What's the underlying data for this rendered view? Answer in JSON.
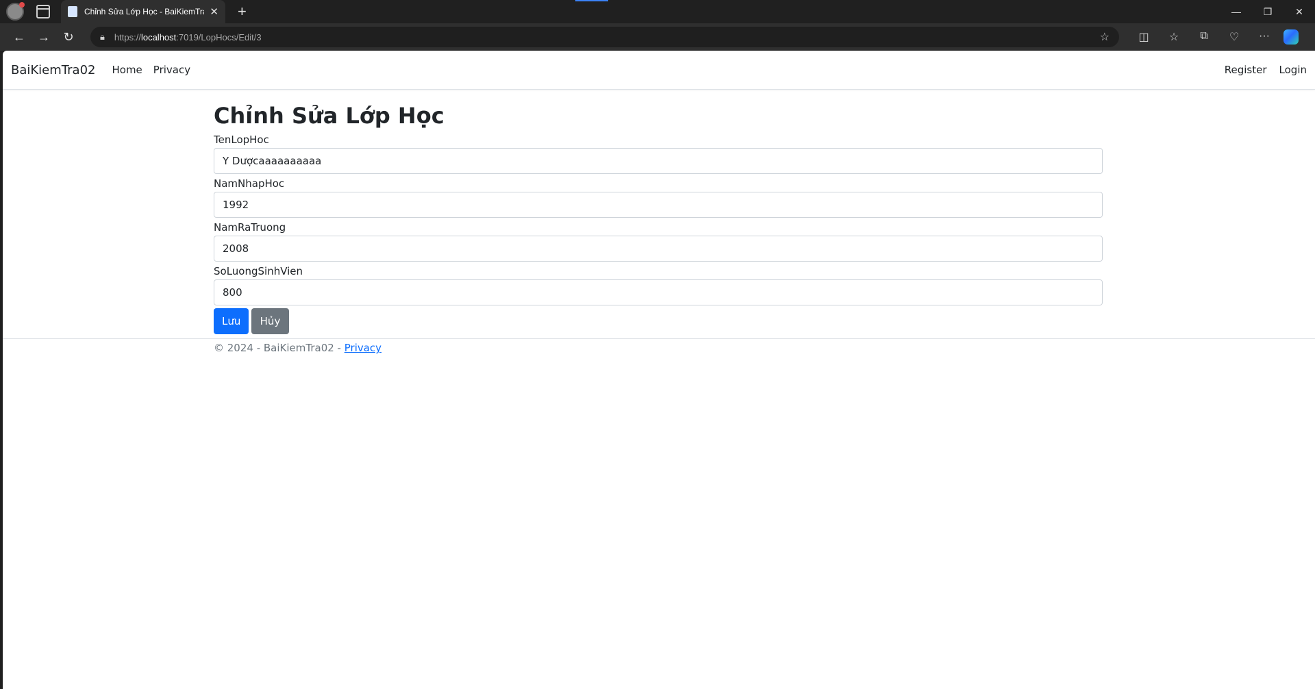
{
  "browser": {
    "tab_title": "Chỉnh Sửa Lớp Học - BaiKiemTra02",
    "url_scheme": "https://",
    "url_host": "localhost",
    "url_path": ":7019/LopHocs/Edit/3",
    "icons": [
      "profile-icon",
      "tab-actions-icon",
      "close-icon",
      "new-tab-icon",
      "back-icon",
      "forward-icon",
      "refresh-icon",
      "lock-icon",
      "star-icon",
      "split-screen-icon",
      "favorites-icon",
      "collections-icon",
      "browser-essentials-icon",
      "more-icon",
      "copilot-icon",
      "minimize-icon",
      "restore-icon",
      "window-close-icon"
    ]
  },
  "navbar": {
    "brand": "BaiKiemTra02",
    "links": [
      "Home",
      "Privacy"
    ],
    "right_links": [
      "Register",
      "Login"
    ]
  },
  "page": {
    "title": "Chỉnh Sửa Lớp Học",
    "fields": [
      {
        "label": "TenLopHoc",
        "value": "Y Dượcaaaaaaaaaa"
      },
      {
        "label": "NamNhapHoc",
        "value": "1992"
      },
      {
        "label": "NamRaTruong",
        "value": "2008"
      },
      {
        "label": "SoLuongSinhVien",
        "value": "800"
      }
    ],
    "save_label": "Lưu",
    "cancel_label": "Hủy"
  },
  "footer": {
    "text": "© 2024 - BaiKiemTra02 - ",
    "link": "Privacy"
  },
  "colors": {
    "primary": "#0d6efd",
    "secondary": "#6c757d",
    "chrome_dark": "#202020"
  }
}
